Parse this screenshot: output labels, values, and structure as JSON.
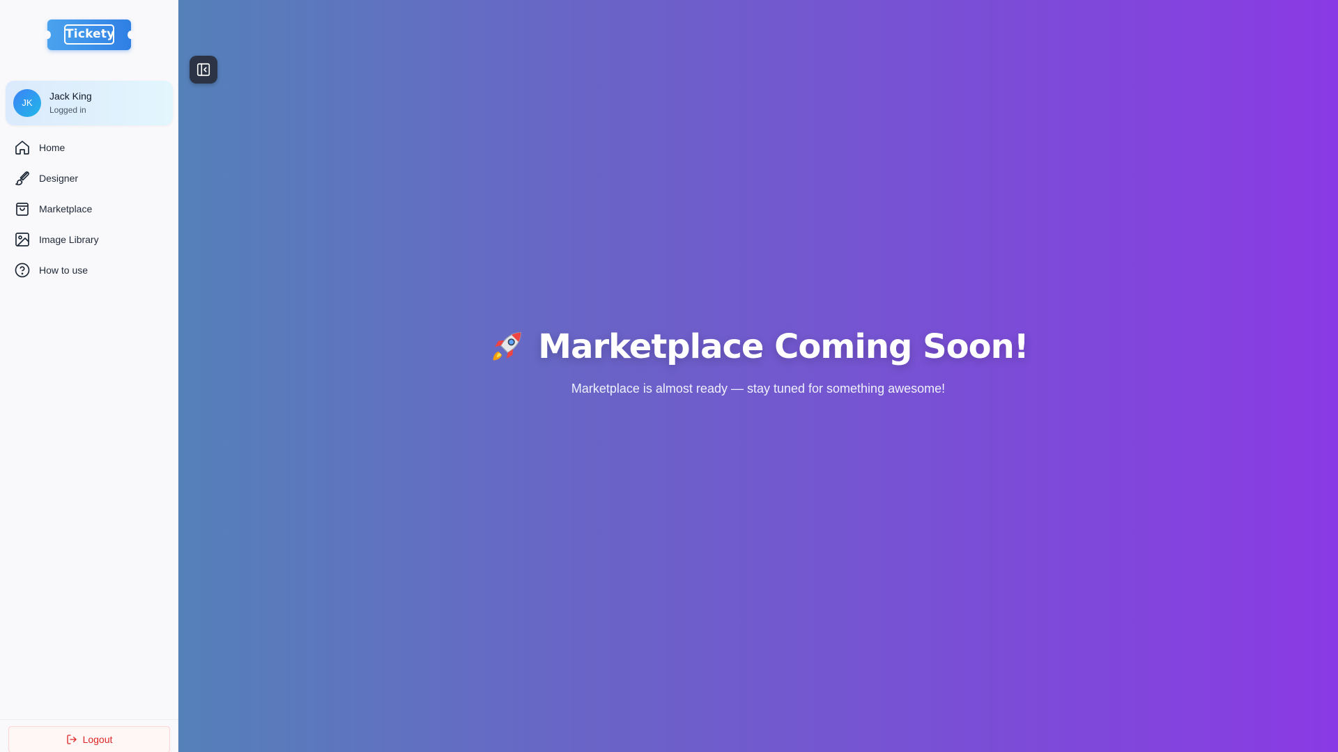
{
  "app": {
    "logo_text": "Tickety"
  },
  "user": {
    "initials": "JK",
    "name": "Jack King",
    "status": "Logged in"
  },
  "sidebar": {
    "items": [
      {
        "label": "Home",
        "icon": "home-icon"
      },
      {
        "label": "Designer",
        "icon": "brush-icon"
      },
      {
        "label": "Marketplace",
        "icon": "shopping-bag-icon"
      },
      {
        "label": "Image Library",
        "icon": "image-icon"
      },
      {
        "label": "How to use",
        "icon": "help-circle-icon"
      }
    ],
    "logout_label": "Logout",
    "toggle_icon": "sidebar-collapse-icon"
  },
  "main": {
    "title": "Marketplace Coming Soon!",
    "title_icon": "rocket-icon",
    "subtitle": "Marketplace is almost ready — stay tuned for something awesome!"
  },
  "colors": {
    "brand": "#2f7fe4",
    "logout": "#dc2626",
    "gradient_start": "#5581b9",
    "gradient_end": "#8a3ae4"
  }
}
